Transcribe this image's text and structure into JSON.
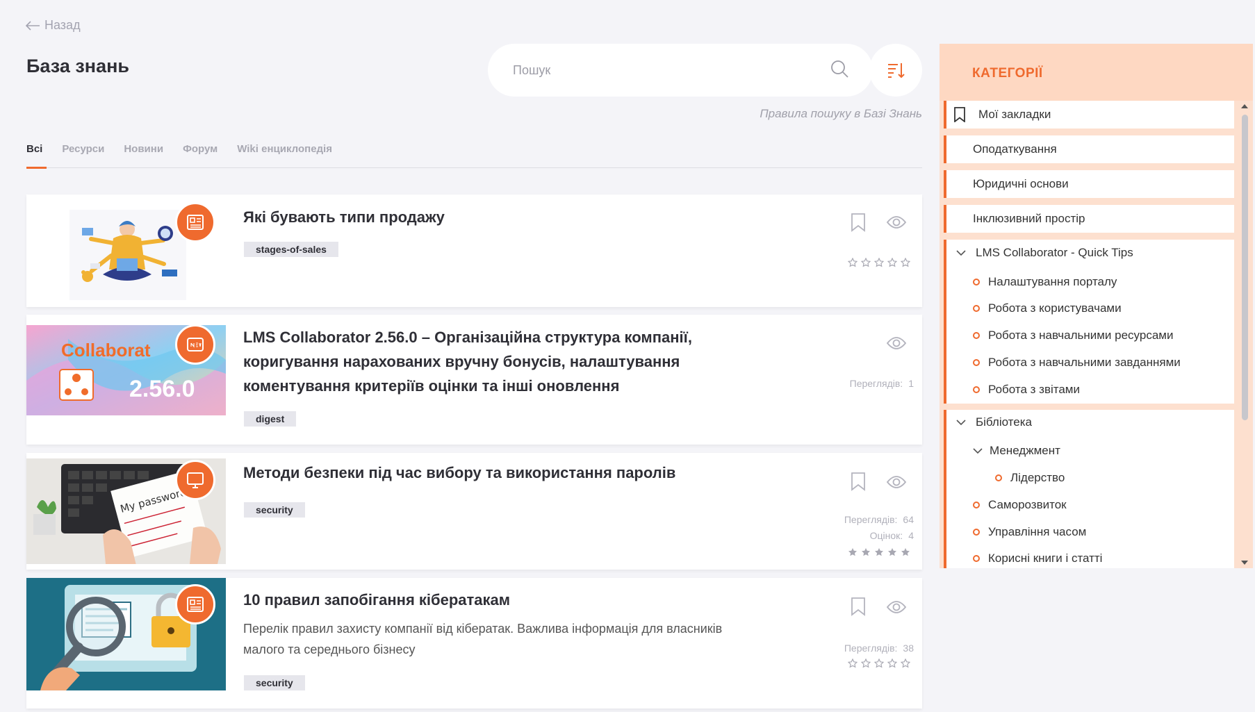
{
  "back_label": "Назад",
  "page_title": "База знань",
  "search": {
    "placeholder": "Пошук"
  },
  "search_rules": "Правила пошуку в Базі Знань",
  "tabs": [
    "Всі",
    "Ресурси",
    "Новини",
    "Форум",
    "Wiki енциклопедія"
  ],
  "active_tab": "Всі",
  "accent_color": "#ef6a2e",
  "cards": [
    {
      "title": "Які бувають типи продажу",
      "tag": "stages-of-sales",
      "badge_icon": "article-icon",
      "rating": 0
    },
    {
      "title_lines": [
        "LMS Collaborator 2.56.0 – Організаційна структура компанії,",
        "коригування нарахованих вручну бонусів, налаштування",
        "коментування критеріїв оцінки та інші оновлення"
      ],
      "tag": "digest",
      "badge_icon": "news-icon",
      "views_label": "Переглядів:",
      "views": "1",
      "thumb_brand": "Collaborat",
      "thumb_version": "2.56.0"
    },
    {
      "title": "Методи безпеки під час вибору та використання паролів",
      "tag": "security",
      "badge_icon": "monitor-icon",
      "views_label": "Переглядів:",
      "views": "64",
      "ratings_label": "Оцінок:",
      "ratings": "4",
      "rating": 5,
      "thumb_text": "My password"
    },
    {
      "title": "10 правил запобігання кібератакам",
      "desc_lines": [
        "Перелік правил захисту компанії від кібератак. Важлива інформація для власників",
        "малого та середнього бізнесу"
      ],
      "tag": "security",
      "badge_icon": "article-icon",
      "views_label": "Переглядів:",
      "views": "38",
      "rating": 0
    }
  ],
  "categories": {
    "title": "КАТЕГОРІЇ",
    "items": [
      "Мої закладки",
      "Оподаткування",
      "Юридичні основи",
      "Інклюзивний простір"
    ],
    "lms_group": {
      "label": "LMS Collaborator - Quick Tips",
      "children": [
        "Налаштування порталу",
        "Робота з користувачами",
        "Робота з навчальними ресурсами",
        "Робота з навчальними завданнями",
        "Робота з звітами"
      ]
    },
    "library_group": {
      "label": "Бібліотека",
      "sub": {
        "label": "Менеджмент",
        "children": [
          "Лідерство"
        ]
      },
      "children": [
        "Саморозвиток",
        "Управління часом",
        "Корисні книги і статті"
      ]
    }
  }
}
